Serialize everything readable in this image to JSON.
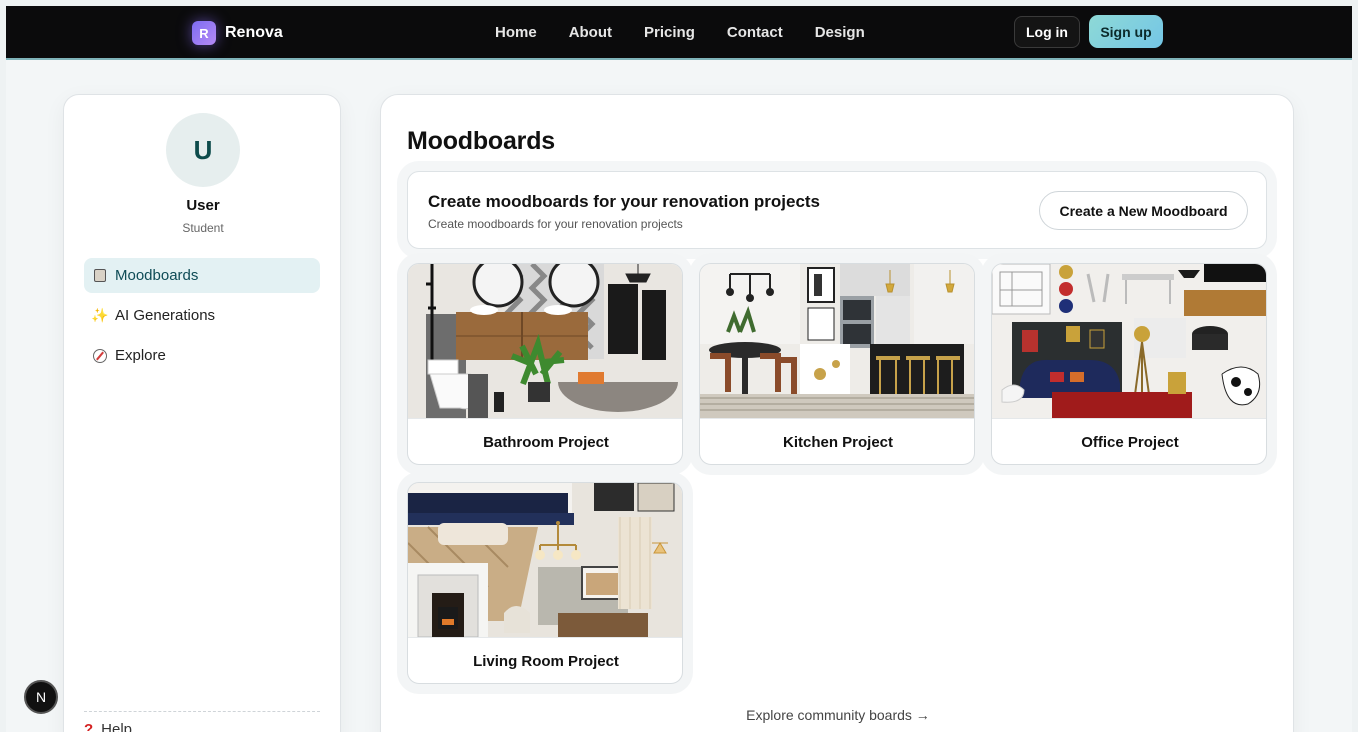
{
  "nav": {
    "brand_initial": "R",
    "brand_name": "Renova",
    "links": [
      "Home",
      "About",
      "Pricing",
      "Contact",
      "Design"
    ],
    "login_label": "Log in",
    "signup_label": "Sign up"
  },
  "sidebar": {
    "avatar_initial": "U",
    "user_name": "User",
    "user_role": "Student",
    "items": [
      {
        "label": "Moodboards",
        "icon": "notebook-icon",
        "active": true
      },
      {
        "label": "AI Generations",
        "icon": "sparkles-icon",
        "active": false
      },
      {
        "label": "Explore",
        "icon": "compass-icon",
        "active": false
      }
    ],
    "help_label": "Help"
  },
  "badge_letter": "N",
  "main": {
    "title": "Moodboards",
    "create_card": {
      "title": "Create moodboards for your renovation projects",
      "subtitle": "Create moodboards for your renovation projects",
      "button_label": "Create a New Moodboard"
    },
    "boards": [
      {
        "label": "Bathroom Project"
      },
      {
        "label": "Kitchen Project"
      },
      {
        "label": "Office Project"
      },
      {
        "label": "Living Room Project"
      }
    ],
    "explore_link": "Explore community boards →"
  },
  "colors": {
    "nav_bg": "#0b0b0c",
    "accent": "#8ed9d6",
    "active_item_bg": "#e3f1f3",
    "brand_logo": "#7d6cf2"
  }
}
